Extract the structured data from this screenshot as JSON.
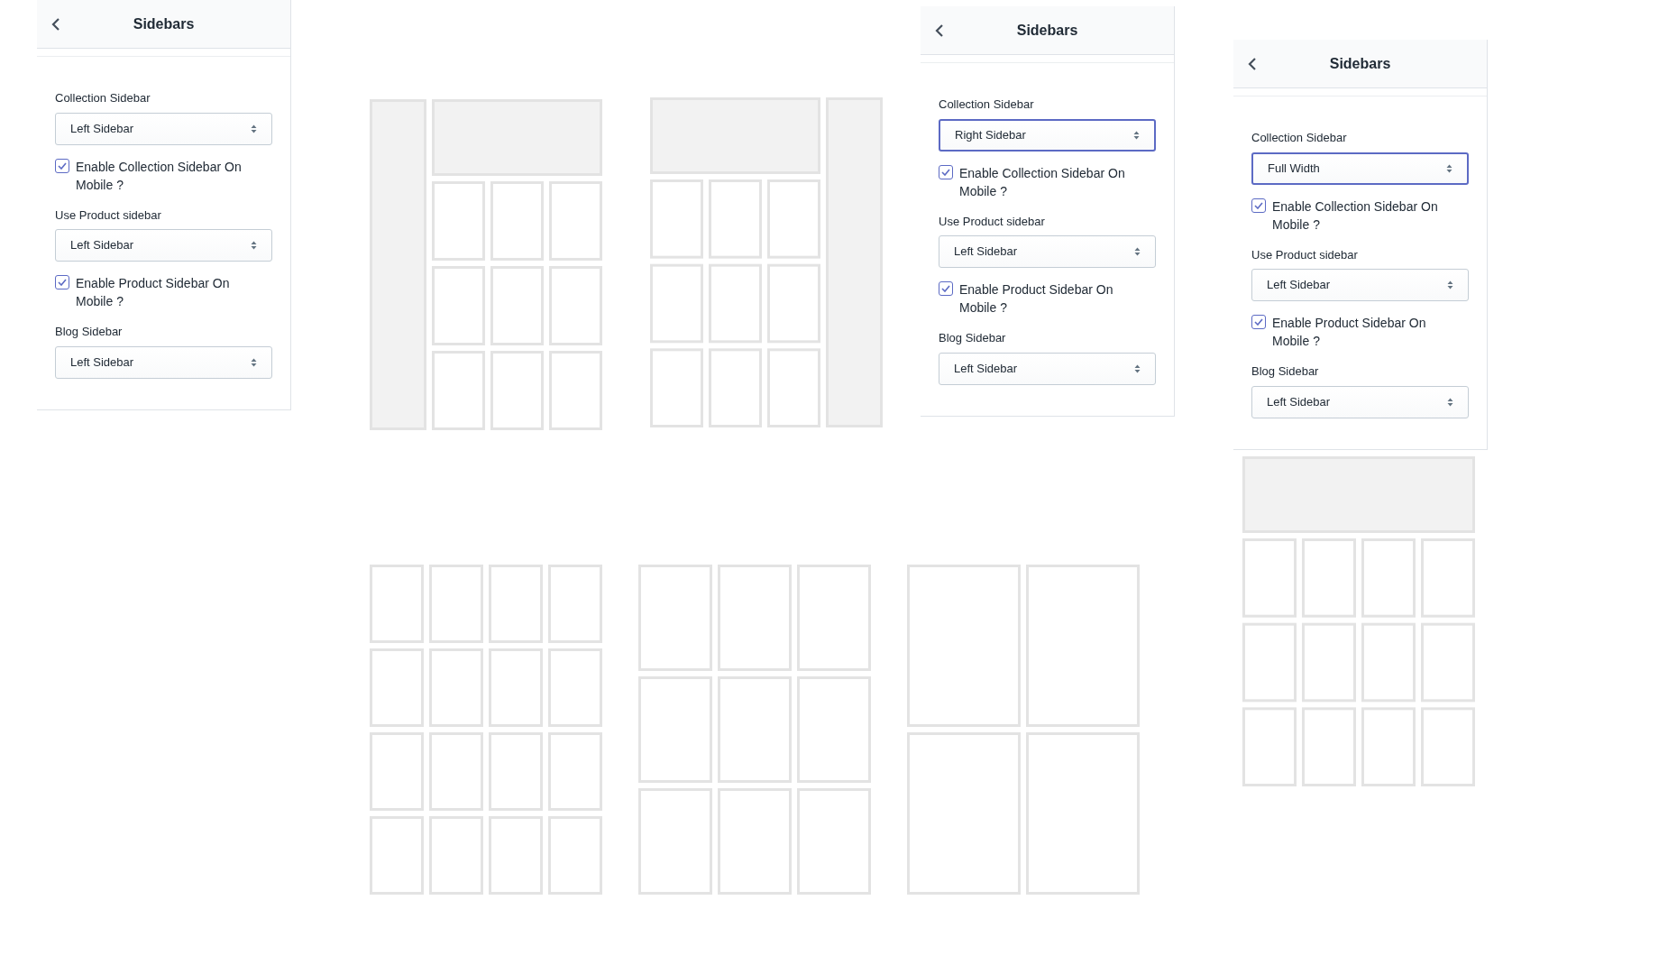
{
  "panels": [
    {
      "title": "Sidebars",
      "fields": [
        {
          "kind": "select",
          "label": "Collection Sidebar",
          "value": "Left Sidebar",
          "focused": false
        },
        {
          "kind": "checkbox",
          "label": "Enable Collection Sidebar On Mobile ?",
          "checked": true
        },
        {
          "kind": "select",
          "label": "Use Product sidebar",
          "value": "Left Sidebar",
          "focused": false
        },
        {
          "kind": "checkbox",
          "label": "Enable Product Sidebar On Mobile ?",
          "checked": true
        },
        {
          "kind": "select",
          "label": "Blog Sidebar",
          "value": "Left Sidebar",
          "focused": false
        }
      ]
    },
    {
      "title": "Sidebars",
      "fields": [
        {
          "kind": "select",
          "label": "Collection Sidebar",
          "value": "Right Sidebar",
          "focused": true
        },
        {
          "kind": "checkbox",
          "label": "Enable Collection Sidebar On Mobile ?",
          "checked": true
        },
        {
          "kind": "select",
          "label": "Use Product sidebar",
          "value": "Left Sidebar",
          "focused": false
        },
        {
          "kind": "checkbox",
          "label": "Enable Product Sidebar On Mobile ?",
          "checked": true
        },
        {
          "kind": "select",
          "label": "Blog Sidebar",
          "value": "Left Sidebar",
          "focused": false
        }
      ]
    },
    {
      "title": "Sidebars",
      "fields": [
        {
          "kind": "select",
          "label": "Collection Sidebar",
          "value": "Full Width",
          "focused": true
        },
        {
          "kind": "checkbox",
          "label": "Enable Collection Sidebar On Mobile ?",
          "checked": true
        },
        {
          "kind": "select",
          "label": "Use Product sidebar",
          "value": "Left Sidebar",
          "focused": false
        },
        {
          "kind": "checkbox",
          "label": "Enable Product Sidebar On Mobile ?",
          "checked": true
        },
        {
          "kind": "select",
          "label": "Blog Sidebar",
          "value": "Left Sidebar",
          "focused": false
        }
      ]
    }
  ]
}
